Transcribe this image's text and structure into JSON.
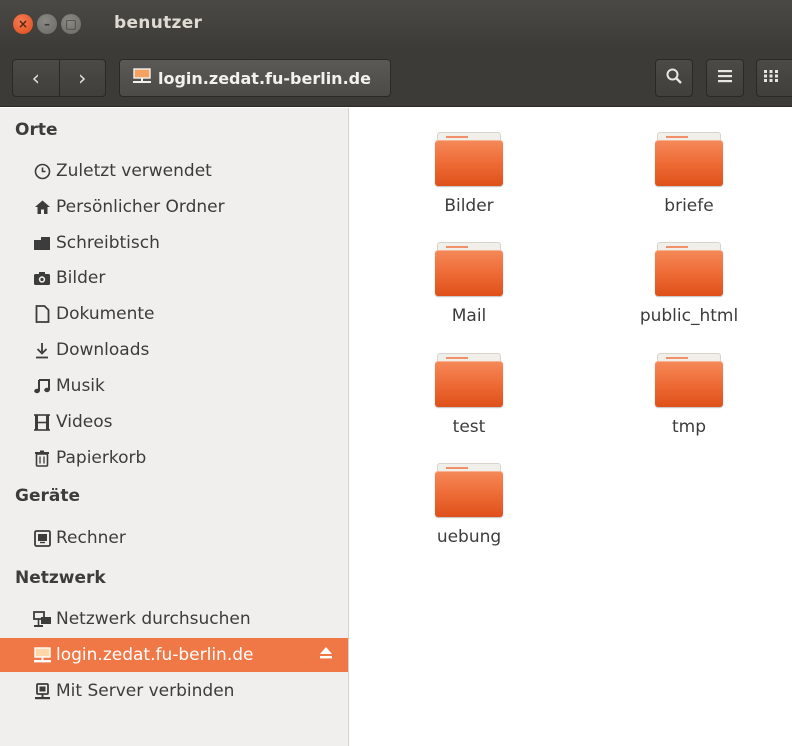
{
  "window": {
    "title": "benutzer",
    "close_glyph": "×",
    "min_glyph": "–",
    "max_glyph": "□"
  },
  "toolbar": {
    "back_glyph": "‹",
    "forward_glyph": "›",
    "path_label": "login.zedat.fu-berlin.de",
    "search_icon": "search-icon",
    "list_icon": "list-view-icon",
    "grid_icon": "grid-view-icon"
  },
  "sidebar": {
    "sections": [
      {
        "heading": "Orte",
        "items": [
          {
            "label": "Zuletzt verwendet",
            "icon": "recent-icon"
          },
          {
            "label": "Persönlicher Ordner",
            "icon": "home-icon"
          },
          {
            "label": "Schreibtisch",
            "icon": "desktop-icon"
          },
          {
            "label": "Bilder",
            "icon": "camera-icon"
          },
          {
            "label": "Dokumente",
            "icon": "document-icon"
          },
          {
            "label": "Downloads",
            "icon": "download-icon"
          },
          {
            "label": "Musik",
            "icon": "music-icon"
          },
          {
            "label": "Videos",
            "icon": "video-icon"
          },
          {
            "label": "Papierkorb",
            "icon": "trash-icon"
          }
        ]
      },
      {
        "heading": "Geräte",
        "items": [
          {
            "label": "Rechner",
            "icon": "computer-icon"
          }
        ]
      },
      {
        "heading": "Netzwerk",
        "items": [
          {
            "label": "Netzwerk durchsuchen",
            "icon": "network-icon"
          },
          {
            "label": "login.zedat.fu-berlin.de",
            "icon": "network-server-icon",
            "active": true
          },
          {
            "label": "Mit Server verbinden",
            "icon": "server-connect-icon"
          }
        ]
      }
    ]
  },
  "folders": [
    {
      "name": "Bilder"
    },
    {
      "name": "briefe"
    },
    {
      "name": "Mail"
    },
    {
      "name": "public_html"
    },
    {
      "name": "test"
    },
    {
      "name": "tmp"
    },
    {
      "name": "uebung"
    }
  ],
  "colors": {
    "accent": "#f07746",
    "titlebar": "#3c3b37",
    "sidebar_bg": "#f0efed",
    "folder": "#ee6b36"
  }
}
